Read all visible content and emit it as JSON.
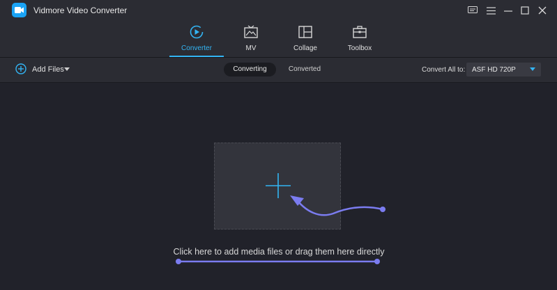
{
  "app": {
    "title": "Vidmore Video Converter"
  },
  "window_controls": [
    "feedback-icon",
    "menu-icon",
    "minimize-icon",
    "maximize-icon",
    "close-icon"
  ],
  "nav": {
    "tabs": [
      {
        "label": "Converter",
        "icon": "converter-icon",
        "active": true
      },
      {
        "label": "MV",
        "icon": "mv-icon",
        "active": false
      },
      {
        "label": "Collage",
        "icon": "collage-icon",
        "active": false
      },
      {
        "label": "Toolbox",
        "icon": "toolbox-icon",
        "active": false
      }
    ]
  },
  "toolbar": {
    "add_files_label": "Add Files",
    "segments": [
      "Converting",
      "Converted"
    ],
    "active_segment": "Converting",
    "convert_all_label": "Convert All to:",
    "format_value": "ASF HD 720P"
  },
  "main": {
    "hint": "Click here to add media files or drag them here directly"
  },
  "colors": {
    "accent": "#33b5f4",
    "annotation": "#7b7cf0",
    "background": "#21222a",
    "bar": "#2b2c33"
  }
}
